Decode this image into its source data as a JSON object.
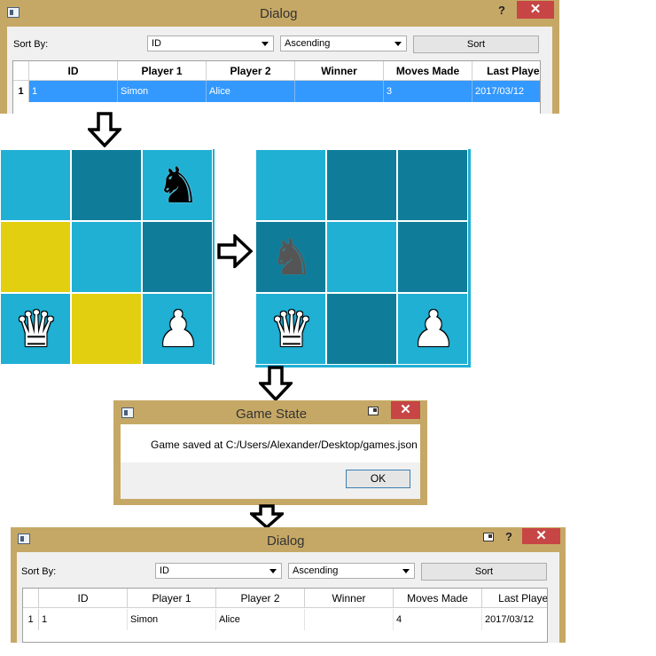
{
  "dialog_before": {
    "title": "Dialog",
    "sort_by_label": "Sort By:",
    "sort_field": "ID",
    "sort_order": "Ascending",
    "sort_button": "Sort",
    "help_glyph": "?",
    "close_glyph": "✕",
    "columns": [
      "ID",
      "Player 1",
      "Player 2",
      "Winner",
      "Moves Made",
      "Last Played"
    ],
    "rows": [
      {
        "row_number": "1",
        "cells": [
          "1",
          "Simon",
          "Alice",
          "",
          "3",
          "2017/03/12"
        ],
        "selected": true
      }
    ]
  },
  "board_before": {
    "squares": [
      [
        "light",
        "dark",
        "light"
      ],
      [
        "yellow",
        "light",
        "dark"
      ],
      [
        "light",
        "yellow",
        "light"
      ]
    ],
    "pieces": [
      {
        "row": 0,
        "col": 2,
        "glyph": "♞",
        "color": "black",
        "name": "black-knight-icon"
      },
      {
        "row": 2,
        "col": 0,
        "glyph": "♛",
        "color": "white",
        "name": "white-queen-icon"
      },
      {
        "row": 2,
        "col": 2,
        "glyph": "♟",
        "color": "white",
        "name": "white-pawn-icon"
      }
    ]
  },
  "board_after": {
    "squares": [
      [
        "light",
        "dark",
        "dark"
      ],
      [
        "dark",
        "light",
        "dark"
      ],
      [
        "light",
        "dark",
        "light"
      ]
    ],
    "pieces": [
      {
        "row": 1,
        "col": 0,
        "glyph": "♞",
        "color": "grey",
        "name": "grey-knight-icon"
      },
      {
        "row": 2,
        "col": 0,
        "glyph": "♛",
        "color": "white",
        "name": "white-queen-icon"
      },
      {
        "row": 2,
        "col": 2,
        "glyph": "♟",
        "color": "white",
        "name": "white-pawn-icon"
      }
    ]
  },
  "game_state_dialog": {
    "title": "Game State",
    "message": "Game saved at C:/Users/Alexander/Desktop/games.json",
    "ok_button": "OK",
    "close_glyph": "✕"
  },
  "dialog_after": {
    "title": "Dialog",
    "sort_by_label": "Sort By:",
    "sort_field": "ID",
    "sort_order": "Ascending",
    "sort_button": "Sort",
    "help_glyph": "?",
    "close_glyph": "✕",
    "columns": [
      "ID",
      "Player 1",
      "Player 2",
      "Winner",
      "Moves Made",
      "Last Played"
    ],
    "rows": [
      {
        "row_number": "1",
        "cells": [
          "1",
          "Simon",
          "Alice",
          "",
          "4",
          "2017/03/12"
        ],
        "selected": false
      }
    ]
  },
  "colors": {
    "frame": "#c6a866",
    "board_light": "#20b0d4",
    "board_dark": "#0f7d99",
    "highlight": "#e2cf10",
    "selection": "#3399ff",
    "close_button": "#c74545"
  }
}
